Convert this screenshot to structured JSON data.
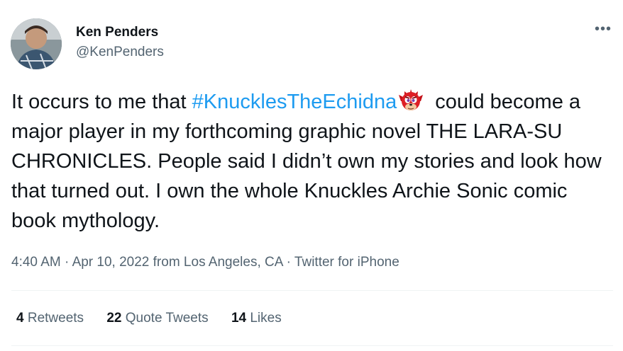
{
  "author": {
    "name": "Ken Penders",
    "handle": "@KenPenders"
  },
  "tweet": {
    "text_part1": "It occurs to me that ",
    "hashtag": "#KnucklesTheEchidna",
    "emoji": "knuckles-emoji",
    "text_part2": " could become a major player in my forthcoming graphic novel THE LARA-SU CHRONICLES. People said I didn’t own my stories and look how that turned out. I own the whole Knuckles Archie Sonic comic book mythology."
  },
  "meta": {
    "time": "4:40 AM",
    "sep1": " · ",
    "date": "Apr 10, 2022",
    "location": " from Los Angeles, CA",
    "sep2": " · ",
    "source": "Twitter for iPhone"
  },
  "stats": {
    "retweets_count": "4",
    "retweets_label": "Retweets",
    "quotes_count": "22",
    "quotes_label": "Quote Tweets",
    "likes_count": "14",
    "likes_label": "Likes"
  },
  "colors": {
    "link": "#1d9bf0",
    "text": "#0f1419",
    "secondary": "#536471"
  }
}
